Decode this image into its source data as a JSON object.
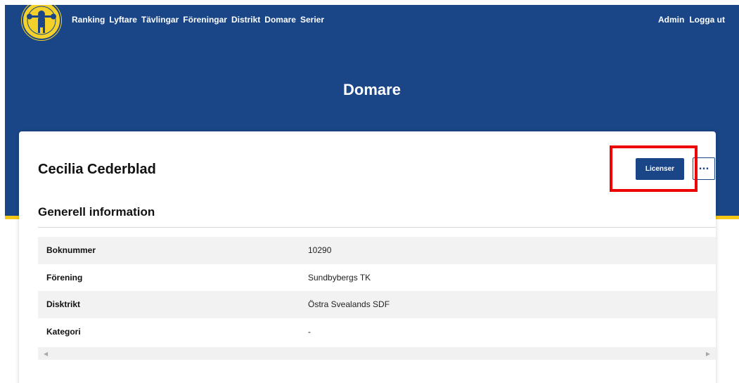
{
  "nav": {
    "items": [
      {
        "label": "Ranking"
      },
      {
        "label": "Lyftare"
      },
      {
        "label": "Tävlingar"
      },
      {
        "label": "Föreningar"
      },
      {
        "label": "Distrikt"
      },
      {
        "label": "Domare"
      },
      {
        "label": "Serier"
      }
    ],
    "right": [
      {
        "label": "Admin"
      },
      {
        "label": "Logga ut"
      }
    ]
  },
  "page": {
    "title": "Domare"
  },
  "card": {
    "name": "Cecilia Cederblad",
    "licenser_label": "Licenser",
    "more_label": "...",
    "section_title": "Generell information",
    "rows": [
      {
        "label": "Boknummer",
        "value": "10290"
      },
      {
        "label": "Förening",
        "value": "Sundbybergs TK"
      },
      {
        "label": "Disktrikt",
        "value": "Östra Svealands SDF"
      },
      {
        "label": "Kategori",
        "value": "-"
      }
    ]
  },
  "scrollbar": {
    "left_arrow": "◀",
    "right_arrow": "▶"
  },
  "colors": {
    "brand_blue": "#1a4687",
    "accent_yellow": "#f7c716",
    "highlight_red": "#ee0000"
  },
  "icons": {
    "logo": "federation-logo",
    "more": "ellipsis-icon"
  }
}
